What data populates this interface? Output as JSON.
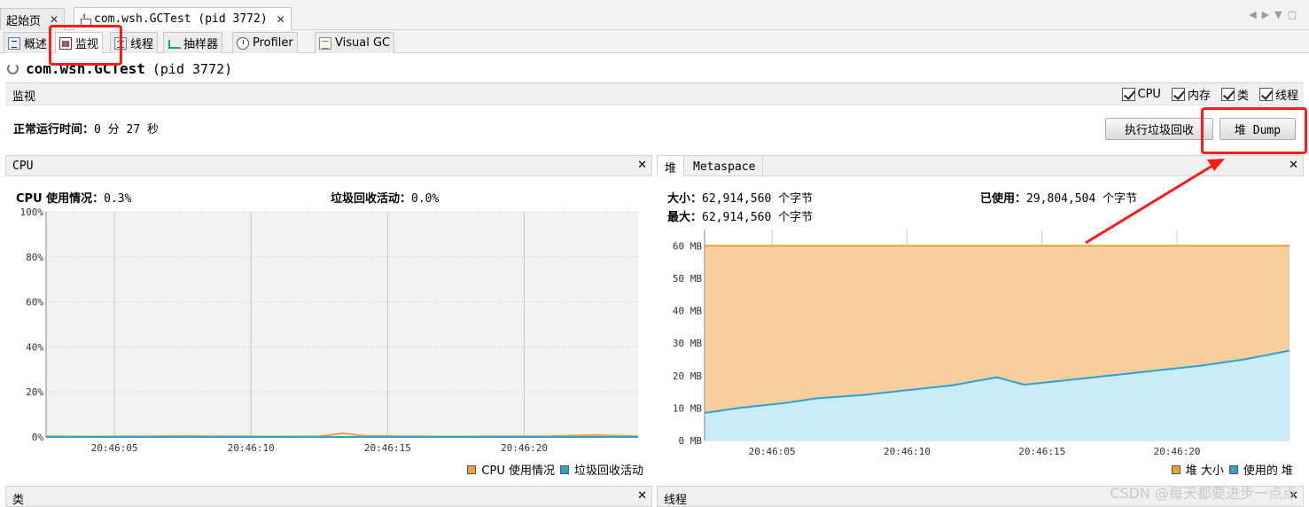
{
  "doc_tabs": [
    {
      "label": "起始页"
    },
    {
      "label": "com.wsh.GCTest (pid 3772)"
    }
  ],
  "sub_tabs": [
    "概述",
    "监视",
    "线程",
    "抽样器",
    "Profiler",
    "Visual GC"
  ],
  "title": {
    "app": "com.wsh.GCTest",
    "pid": "(pid 3772)"
  },
  "section": {
    "label": "监视",
    "checks": [
      {
        "label": "CPU",
        "checked": true
      },
      {
        "label": "内存",
        "checked": true
      },
      {
        "label": "类",
        "checked": true
      },
      {
        "label": "线程",
        "checked": true
      }
    ]
  },
  "uptime": {
    "label": "正常运行时间：",
    "value": "0 分 27 秒"
  },
  "buttons": {
    "gc": "执行垃圾回收",
    "heap_dump": "堆 Dump"
  },
  "cpu_panel": {
    "title": "CPU",
    "cpu_label": "CPU 使用情况：",
    "cpu_value": "0.3%",
    "gc_label": "垃圾回收活动：",
    "gc_value": "0.0%",
    "legend": [
      "CPU 使用情况",
      "垃圾回收活动"
    ]
  },
  "heap_panel": {
    "tabs": [
      "堆",
      "Metaspace"
    ],
    "size_label": "大小：",
    "size_value": "62,914,560 个字节",
    "used_label": "已使用：",
    "used_value": "29,804,504 个字节",
    "max_label": "最大：",
    "max_value": "62,914,560 个字节",
    "legend": [
      "堆 大小",
      "使用的 堆"
    ]
  },
  "bottom_panels": {
    "left": "类",
    "right": "线程"
  },
  "watermark": "CSDN @每天都要进步一点点",
  "colors": {
    "orange": "#e8a23a",
    "blue": "#2ba3cf",
    "red_highlight": "#ff1a1a"
  },
  "chart_data": [
    {
      "type": "line",
      "title": "CPU",
      "x_ticks": [
        "20:46:05",
        "20:46:10",
        "20:46:15",
        "20:46:20"
      ],
      "y_ticks": [
        "0%",
        "20%",
        "40%",
        "60%",
        "80%",
        "100%"
      ],
      "ylim": [
        0,
        100
      ],
      "series": [
        {
          "name": "CPU 使用情况",
          "color": "#e8a23a",
          "x": [
            0,
            2,
            4,
            6,
            8,
            10,
            12,
            13,
            14,
            16,
            18,
            20,
            22,
            24,
            26
          ],
          "values": [
            0.3,
            0.2,
            0.3,
            0.4,
            0.3,
            0.2,
            0.3,
            1.6,
            0.5,
            0.3,
            0.2,
            0.3,
            0.3,
            0.9,
            0.3
          ]
        },
        {
          "name": "垃圾回收活动",
          "color": "#2ba3cf",
          "x": [
            0,
            26
          ],
          "values": [
            0.0,
            0.0
          ]
        }
      ]
    },
    {
      "type": "area",
      "title": "堆",
      "x_ticks": [
        "20:46:05",
        "20:46:10",
        "20:46:15",
        "20:46:20"
      ],
      "y_ticks": [
        "0 MB",
        "10 MB",
        "20 MB",
        "30 MB",
        "40 MB",
        "50 MB",
        "60 MB"
      ],
      "ylim": [
        0,
        65
      ],
      "series": [
        {
          "name": "堆 大小",
          "color": "#e8a23a",
          "x": [
            0,
            26
          ],
          "values": [
            60,
            60
          ]
        },
        {
          "name": "使用的 堆",
          "color": "#2ba3cf",
          "x": [
            0,
            1.5,
            3.5,
            5,
            7,
            9,
            11,
            13,
            14.2,
            16,
            18,
            20,
            22,
            24,
            26
          ],
          "values": [
            8.5,
            10,
            11.5,
            13,
            14,
            15.5,
            17,
            19.5,
            17.2,
            18.5,
            20,
            21.5,
            23,
            25,
            27.7
          ]
        }
      ]
    }
  ]
}
